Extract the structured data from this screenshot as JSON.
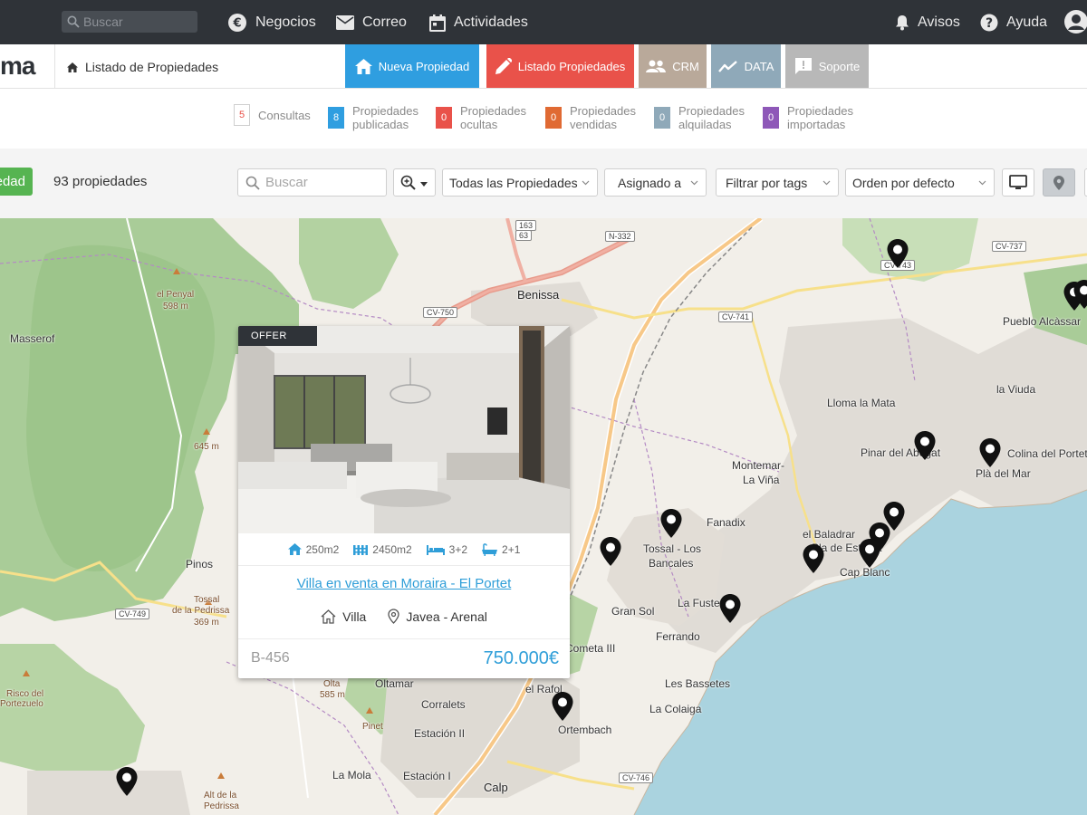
{
  "topbar": {
    "search_placeholder": "Buscar",
    "nav": [
      {
        "label": "Negocios",
        "icon": "euro-icon"
      },
      {
        "label": "Correo",
        "icon": "mail-icon"
      },
      {
        "label": "Actividades",
        "icon": "calendar-icon"
      },
      {
        "label": "Avisos",
        "icon": "bell-icon"
      },
      {
        "label": "Ayuda",
        "icon": "help-icon"
      }
    ]
  },
  "header": {
    "logo": "ma",
    "breadcrumb": "Listado de Propiedades",
    "tabs": [
      {
        "label": "Nueva Propiedad",
        "color": "#2f9ee0"
      },
      {
        "label": "Listado Propiedades",
        "color": "#e9524a"
      },
      {
        "label": "CRM",
        "color": "#b9a99a"
      },
      {
        "label": "DATA",
        "color": "#8fa9b9"
      },
      {
        "label": "Soporte",
        "color": "#b8b8b8"
      }
    ]
  },
  "stats": [
    {
      "count": "5",
      "line1": "Consultas",
      "line2": "",
      "color": "#ffffff",
      "text_color": "#e9524a"
    },
    {
      "count": "8",
      "line1": "Propiedades",
      "line2": "publicadas",
      "color": "#2f9ee0",
      "text_color": "#ffffff"
    },
    {
      "count": "0",
      "line1": "Propiedades",
      "line2": "ocultas",
      "color": "#e9524a",
      "text_color": "#ffffff"
    },
    {
      "count": "0",
      "line1": "Propiedades",
      "line2": "vendidas",
      "color": "#e06a33",
      "text_color": "#ffffff"
    },
    {
      "count": "0",
      "line1": "Propiedades",
      "line2": "alquiladas",
      "color": "#8fa9b9",
      "text_color": "#ffffff"
    },
    {
      "count": "0",
      "line1": "Propiedades",
      "line2": "importadas",
      "color": "#8e58b8",
      "text_color": "#ffffff"
    }
  ],
  "filters": {
    "add_label": "Nueva Propiedad",
    "count_label": "93 propiedades",
    "search_placeholder": "Buscar",
    "property_filter": "Todas las Propiedades",
    "assigned": "Asignado a",
    "tags": "Filtrar por tags",
    "order": "Orden por defecto"
  },
  "map": {
    "places": [
      {
        "name": "Benissa",
        "cls": "big"
      },
      {
        "name": "el Penyal",
        "cls": "small"
      },
      {
        "name": "598 m",
        "cls": "small"
      },
      {
        "name": "Masserof",
        "cls": ""
      },
      {
        "name": "645 m",
        "cls": "small"
      },
      {
        "name": "Pinos",
        "cls": ""
      },
      {
        "name": "Tossal",
        "cls": "small"
      },
      {
        "name": "de la Pedrissa",
        "cls": "small"
      },
      {
        "name": "369 m",
        "cls": "small"
      },
      {
        "name": "Risco del",
        "cls": "small"
      },
      {
        "name": "Portezuelo",
        "cls": "small"
      },
      {
        "name": "Pueblo Alcàssar",
        "cls": ""
      },
      {
        "name": "la Viuda",
        "cls": ""
      },
      {
        "name": "Lloma la Mata",
        "cls": ""
      },
      {
        "name": "Pinar del Abogat",
        "cls": ""
      },
      {
        "name": "Colina del Portet",
        "cls": ""
      },
      {
        "name": "Plà del Mar",
        "cls": ""
      },
      {
        "name": "Montemar-",
        "cls": ""
      },
      {
        "name": "La Viña",
        "cls": ""
      },
      {
        "name": "Fanadix",
        "cls": ""
      },
      {
        "name": "el Baladrar",
        "cls": ""
      },
      {
        "name": "Pla de Estrella",
        "cls": ""
      },
      {
        "name": "Cap Blanc",
        "cls": ""
      },
      {
        "name": "Tossal - Los",
        "cls": ""
      },
      {
        "name": "Bancales",
        "cls": ""
      },
      {
        "name": "La Fustera",
        "cls": ""
      },
      {
        "name": "Gran Sol",
        "cls": ""
      },
      {
        "name": "Ferrando",
        "cls": ""
      },
      {
        "name": "Cometa III",
        "cls": ""
      },
      {
        "name": "Oltamar",
        "cls": ""
      },
      {
        "name": "Olta",
        "cls": "small"
      },
      {
        "name": "585 m",
        "cls": "small"
      },
      {
        "name": "Corralets",
        "cls": ""
      },
      {
        "name": "Pinet",
        "cls": "small"
      },
      {
        "name": "Estación II",
        "cls": ""
      },
      {
        "name": "el Rafol",
        "cls": ""
      },
      {
        "name": "Ortembach",
        "cls": ""
      },
      {
        "name": "Les Bassetes",
        "cls": ""
      },
      {
        "name": "La Colaiga",
        "cls": ""
      },
      {
        "name": "La Mola",
        "cls": ""
      },
      {
        "name": "Estación I",
        "cls": ""
      },
      {
        "name": "Calp",
        "cls": "big"
      },
      {
        "name": "Alt de la",
        "cls": "small"
      },
      {
        "name": "Pedrissa",
        "cls": "small"
      },
      {
        "name": "CV-750",
        "cls": "road"
      },
      {
        "name": "CV-741",
        "cls": "road"
      },
      {
        "name": "CV-737",
        "cls": "road"
      },
      {
        "name": "CV-743",
        "cls": "road"
      },
      {
        "name": "N-332",
        "cls": "road"
      },
      {
        "name": "CV-749",
        "cls": "road"
      },
      {
        "name": "CV-746",
        "cls": "road"
      },
      {
        "name": "163",
        "cls": "road"
      },
      {
        "name": "63",
        "cls": "road"
      }
    ]
  },
  "card": {
    "badge": "OFFER",
    "features": {
      "area": "250m2",
      "plot": "2450m2",
      "beds": "3+2",
      "baths": "2+1"
    },
    "title": "Villa en venta en Moraira - El Portet",
    "type": "Villa",
    "location": "Javea - Arenal",
    "ref": "B-456",
    "price": "750.000€"
  }
}
